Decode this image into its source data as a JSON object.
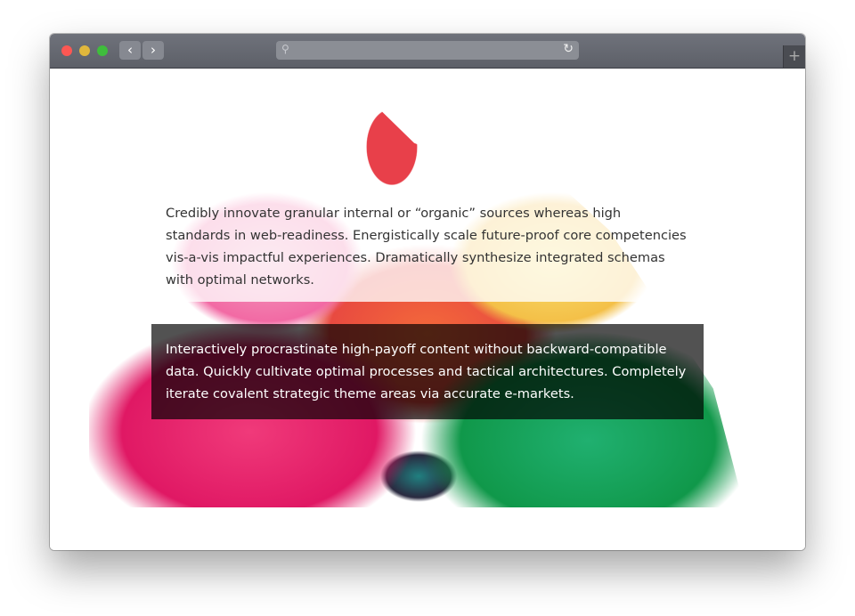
{
  "browser": {
    "back_icon": "chevron-left",
    "forward_icon": "chevron-right",
    "search_icon": "magnifier",
    "reload_icon": "reload",
    "new_tab_icon": "plus",
    "back_label": "‹",
    "forward_label": "›",
    "new_tab_label": "+"
  },
  "content": {
    "paragraph_1": "Credibly innovate granular internal or “organic” sources whereas high standards in web-readiness. Energistically scale future-proof core competencies vis-a-vis impactful experiences. Dramatically synthesize integrated schemas with optimal networks.",
    "paragraph_2": "Interactively procrastinate high-payoff content without backward-compatible data. Quickly cultivate optimal processes and tactical architectures. Completely iterate covalent strategic theme areas via accurate e-markets."
  },
  "colors": {
    "close": "#fc5753",
    "minimize": "#e0b73c",
    "zoom": "#3fbd3c"
  }
}
